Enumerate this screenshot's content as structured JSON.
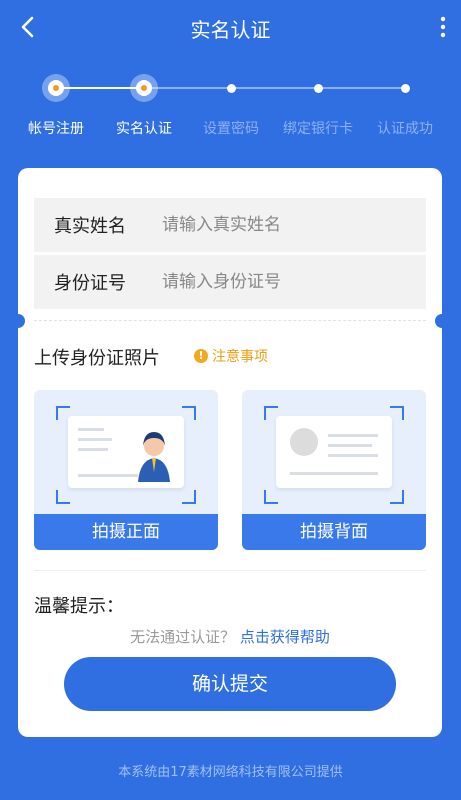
{
  "header": {
    "title": "实名认证",
    "back_icon": "back-arrow-icon",
    "more_icon": "more-vertical-icon"
  },
  "steps": [
    {
      "label": "帐号注册",
      "state": "done"
    },
    {
      "label": "实名认证",
      "state": "current"
    },
    {
      "label": "设置密码",
      "state": "pending"
    },
    {
      "label": "绑定银行卡",
      "state": "pending"
    },
    {
      "label": "认证成功",
      "state": "pending"
    }
  ],
  "form": {
    "name_label": "真实姓名",
    "name_placeholder": "请输入真实姓名",
    "id_label": "身份证号",
    "id_placeholder": "请输入身份证号"
  },
  "upload": {
    "title": "上传身份证照片",
    "notice": "注意事项",
    "front_button": "拍摄正面",
    "back_button": "拍摄背面"
  },
  "tips": {
    "title": "温馨提示：",
    "help_text": "无法通过认证？",
    "help_link": "点击获得帮助"
  },
  "submit_label": "确认提交",
  "footer": "本系统由17素材网络科技有限公司提供",
  "colors": {
    "primary": "#2f6fe2",
    "accent": "#f39a1d",
    "warning": "#e8a016"
  }
}
